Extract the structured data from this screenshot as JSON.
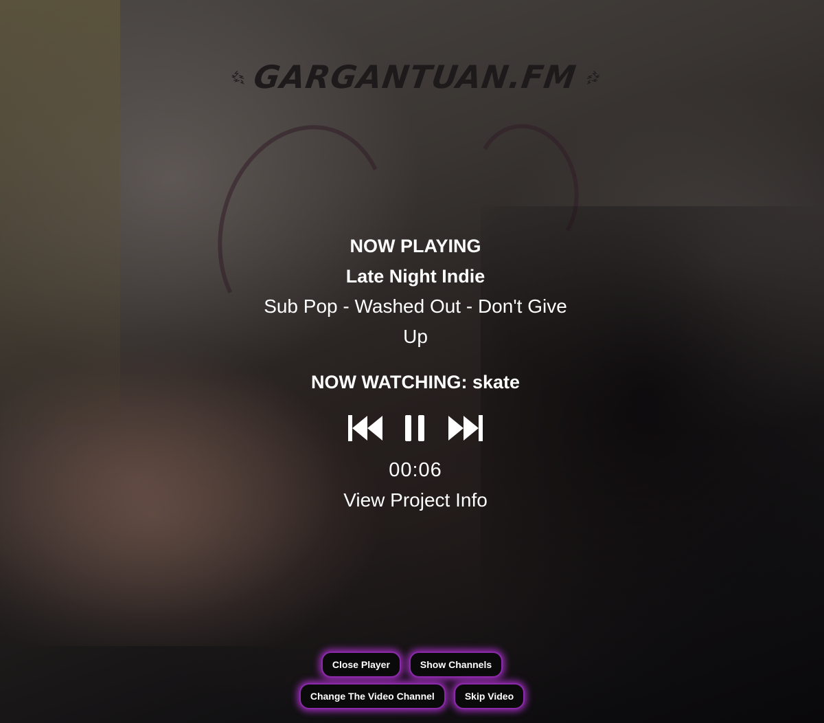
{
  "logo": {
    "text": "GARGANTUAN.FM"
  },
  "player": {
    "now_playing_label": "NOW PLAYING",
    "channel": "Late Night Indie",
    "track": "Sub Pop - Washed Out - Don't Give Up",
    "now_watching": "NOW WATCHING: skate",
    "elapsed": "00:06",
    "project_info_link": "View Project Info",
    "controls": {
      "previous_icon": "skip-previous-icon",
      "pause_icon": "pause-icon",
      "next_icon": "skip-next-icon"
    }
  },
  "buttons": {
    "close_player": "Close Player",
    "show_channels": "Show Channels",
    "change_video_channel": "Change The Video Channel",
    "skip_video": "Skip Video"
  },
  "colors": {
    "button_glow": "#b030d2",
    "button_border": "#8a2aa8",
    "button_bg": "#0a0a0a",
    "text": "#ffffff"
  }
}
